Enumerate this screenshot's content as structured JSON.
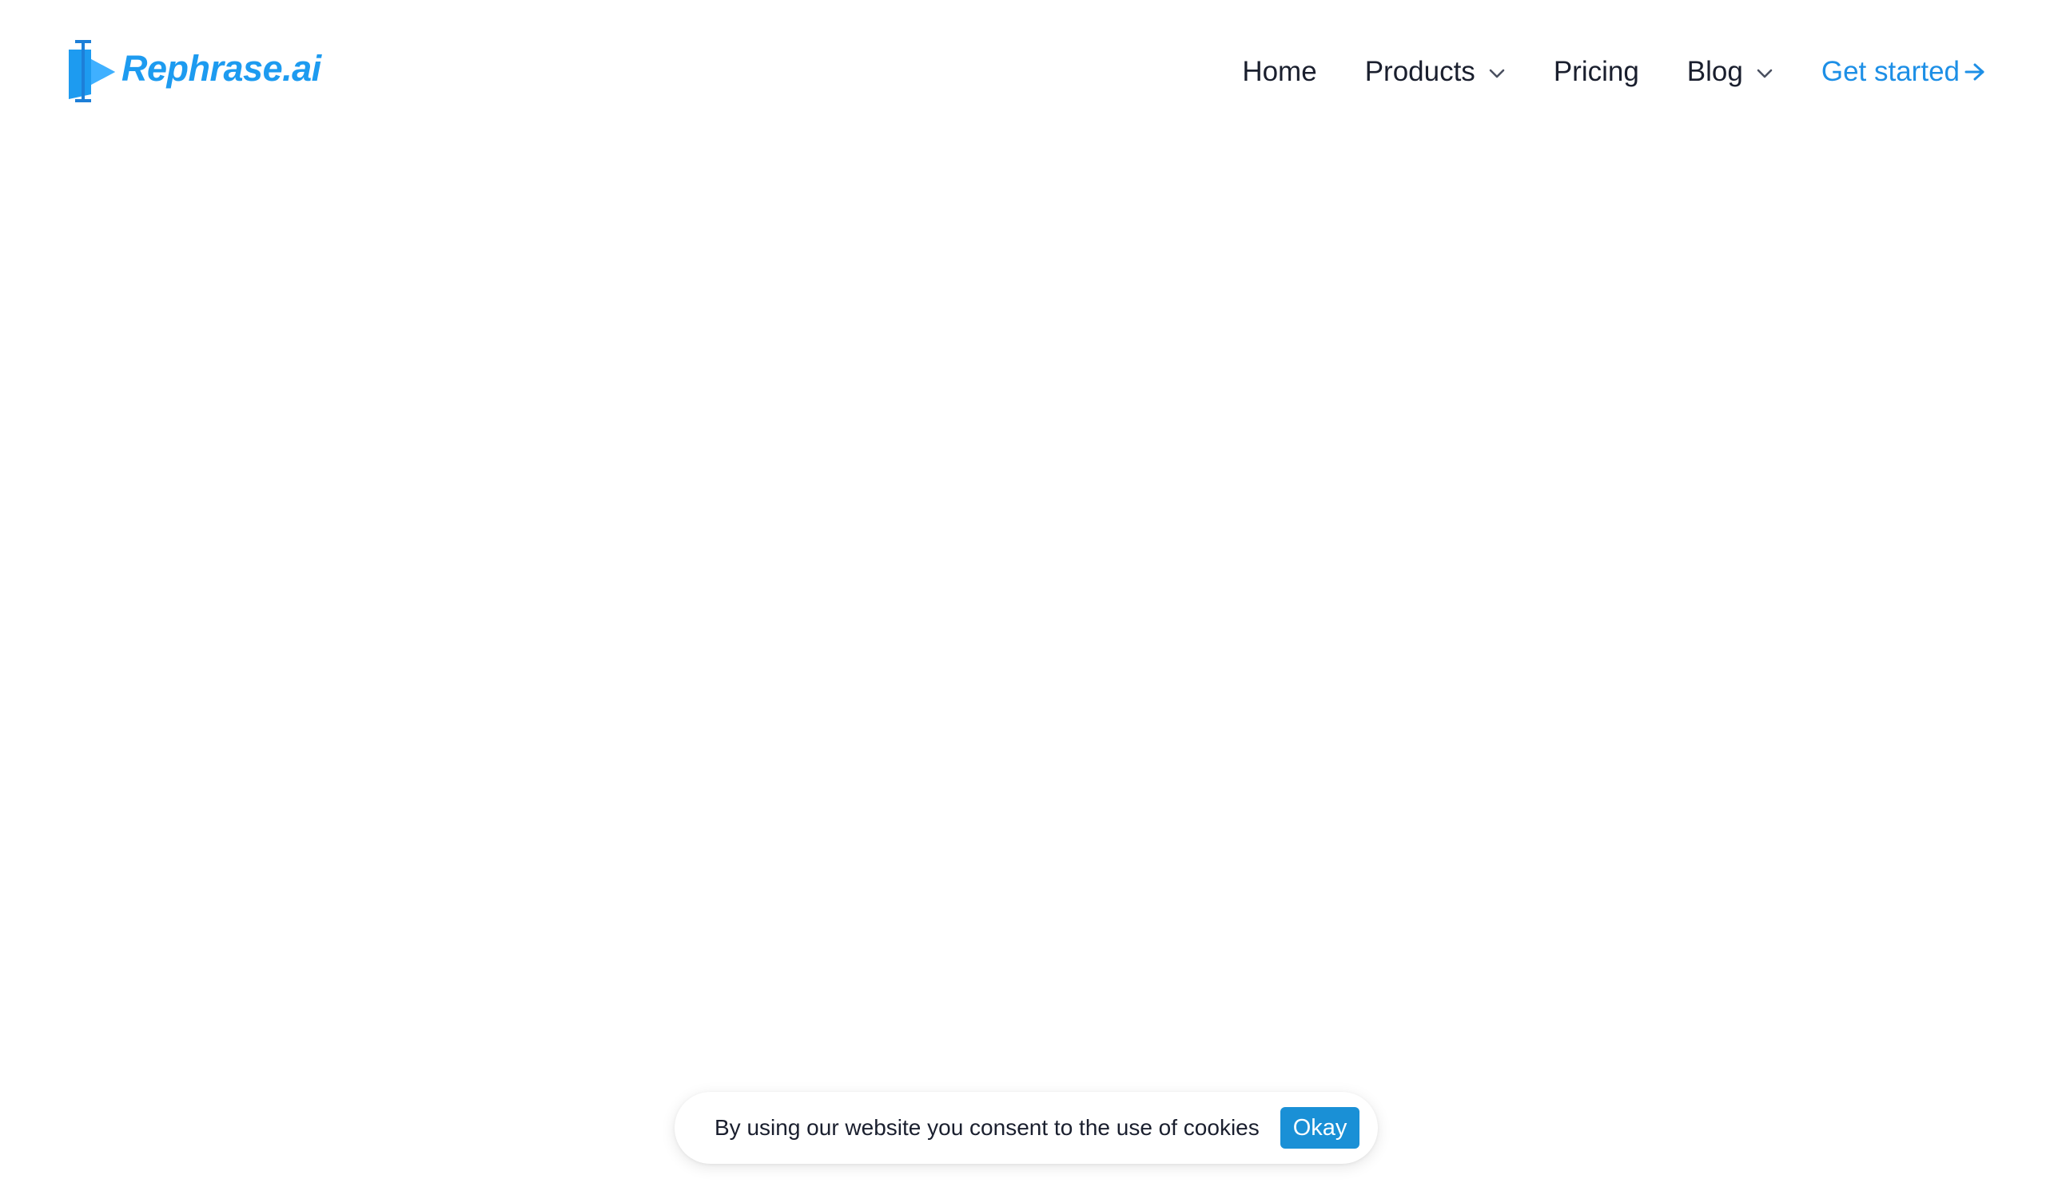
{
  "brand": {
    "name": "Rephrase.ai",
    "logo_icon": "rephrase-flag-logo",
    "color": "#1d9bf0"
  },
  "nav": {
    "items": [
      {
        "label": "Home",
        "has_dropdown": false
      },
      {
        "label": "Products",
        "has_dropdown": true
      },
      {
        "label": "Pricing",
        "has_dropdown": false
      },
      {
        "label": "Blog",
        "has_dropdown": true
      }
    ],
    "cta": {
      "label": "Get started",
      "icon": "arrow-right-icon",
      "color": "#1d8fe6"
    }
  },
  "cookie_banner": {
    "message": "By using our website you consent to the use of cookies",
    "button_label": "Okay",
    "button_color": "#1a90d6"
  }
}
